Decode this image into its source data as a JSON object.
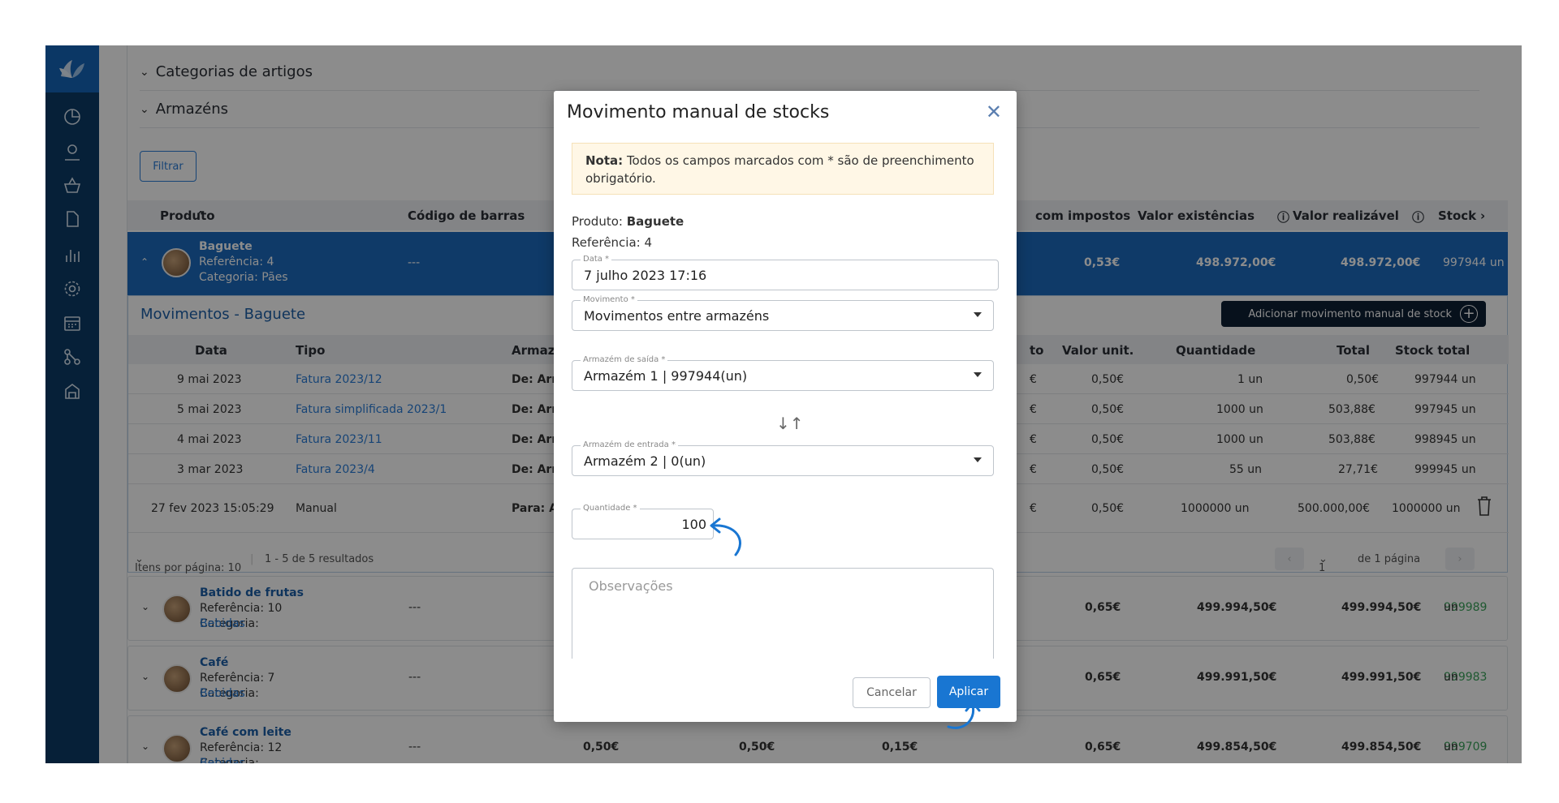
{
  "sidebar": {
    "logo_icon": "leaf-logo-icon",
    "items": [
      {
        "icon": "dashboard-icon"
      },
      {
        "icon": "user-icon"
      },
      {
        "icon": "basket-icon"
      },
      {
        "icon": "document-icon"
      },
      {
        "icon": "chart-icon"
      },
      {
        "icon": "gear-icon"
      },
      {
        "icon": "calendar-icon"
      },
      {
        "icon": "network-icon"
      },
      {
        "icon": "warehouse-icon"
      }
    ]
  },
  "filters": {
    "categories_label": "Categorias de artigos",
    "warehouses_label": "Armazéns",
    "filter_button": "Filtrar"
  },
  "table": {
    "headers": {
      "produto": "Produto",
      "codigo": "Código de barras",
      "com_impostos": "com impostos",
      "valor_existencias": "Valor existências",
      "valor_realizavel": "Valor realizável",
      "stock": "Stock"
    },
    "selected": {
      "name": "Baguete",
      "ref": "Referência: 4",
      "cat": "Categoria: Pães",
      "barcode": "---",
      "price_tax": "0,53€",
      "valor_existencias": "498.972,00€",
      "valor_realizavel": "498.972,00€",
      "stock": "997944 un"
    }
  },
  "movements": {
    "title": "Movimentos - Baguete",
    "add_button": "Adicionar movimento manual de stock",
    "headers": {
      "data": "Data",
      "tipo": "Tipo",
      "armazem": "Armazé",
      "to": "to",
      "valor_unit": "Valor unit.",
      "quantidade": "Quantidade",
      "total": "Total",
      "stock_total": "Stock total"
    },
    "rows": [
      {
        "data": "9 mai 2023",
        "tipo": "Fatura 2023/12",
        "arm": "De: Arm",
        "c": "€",
        "unit": "0,50€",
        "qty": "1 un",
        "total": "0,50€",
        "stock": "997944 un"
      },
      {
        "data": "5 mai 2023",
        "tipo": "Fatura simplificada 2023/1",
        "arm": "De: Arm",
        "c": "€",
        "unit": "0,50€",
        "qty": "1000 un",
        "total": "503,88€",
        "stock": "997945 un"
      },
      {
        "data": "4 mai 2023",
        "tipo": "Fatura 2023/11",
        "arm": "De: Arm",
        "c": "€",
        "unit": "0,50€",
        "qty": "1000 un",
        "total": "503,88€",
        "stock": "998945 un"
      },
      {
        "data": "3 mar 2023",
        "tipo": "Fatura 2023/4",
        "arm": "De: Arm",
        "c": "€",
        "unit": "0,50€",
        "qty": "55 un",
        "total": "27,71€",
        "stock": "999945 un"
      },
      {
        "data": "27 fev 2023 15:05:29",
        "tipo": "Manual",
        "arm": "Para: Ar",
        "c": "€",
        "unit": "0,50€",
        "qty": "1000000 un",
        "total": "500.000,00€",
        "stock": "1000000 un"
      }
    ],
    "pager": {
      "per_page": "Itens por página: 10",
      "results": "1 - 5 de 5 resultados",
      "page": "1",
      "of_pages": "de 1 página"
    }
  },
  "products": [
    {
      "name": "Batido de frutas",
      "ref": "Referência: 10",
      "cat_prefix": "Categoria:",
      "cat": "Bebidas",
      "barcode": "---",
      "price_tax": "0,65€",
      "v1": "499.994,50€",
      "v2": "499.994,50€",
      "stock_num": "999989",
      "stock_unit": "un"
    },
    {
      "name": "Café",
      "ref": "Referência: 7",
      "cat_prefix": "Categoria:",
      "cat": "Bebidas",
      "barcode": "---",
      "price_tax": "0,65€",
      "v1": "499.991,50€",
      "v2": "499.991,50€",
      "stock_num": "999983",
      "stock_unit": "un"
    },
    {
      "name": "Café com leite",
      "ref": "Referência: 12",
      "cat_prefix": "Categoria:",
      "cat": "Bebidas",
      "barcode": "---",
      "p1": "0,50€",
      "p2": "0,50€",
      "p3": "0,15€",
      "price_tax": "0,65€",
      "v1": "499.854,50€",
      "v2": "499.854,50€",
      "stock_num": "999709",
      "stock_unit": "un"
    }
  ],
  "modal": {
    "title": "Movimento manual de stocks",
    "note_bold": "Nota:",
    "note_text": "Todos os campos marcados com * são de preenchimento obrigatório.",
    "produto_label": "Produto:",
    "produto_value": "Baguete",
    "referencia": "Referência: 4",
    "data_label": "Data *",
    "data_value": "7 julho 2023 17:16",
    "movimento_label": "Movimento *",
    "movimento_value": "Movimentos entre armazéns",
    "saida_label": "Armazém de saída *",
    "saida_value": "Armazém 1 | 997944(un)",
    "entrada_label": "Armazém de entrada *",
    "entrada_value": "Armazém 2 | 0(un)",
    "quantidade_label": "Quantidade *",
    "quantidade_value": "100",
    "observacoes_placeholder": "Observações",
    "cancel": "Cancelar",
    "apply": "Aplicar"
  },
  "colors": {
    "sidebar": "#0b3b66",
    "accent": "#1976d2",
    "selected_row": "#1c6bbd",
    "annotation_arrow": "#1976d2"
  }
}
